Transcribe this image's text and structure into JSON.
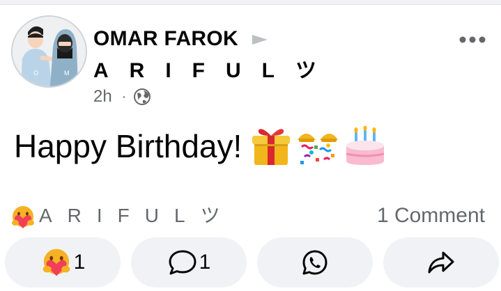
{
  "post": {
    "author": "OMAR FAROK",
    "recipient": "ARIFULツ",
    "time": "2h",
    "separator": "·",
    "privacy_icon": "globe-icon",
    "text": "Happy Birthday!",
    "emojis": [
      "gift",
      "party-poppers",
      "birthday-cake"
    ],
    "avatar_letters": [
      "O",
      "M"
    ]
  },
  "summary": {
    "reaction_icon": "care-reaction-icon",
    "reactor_name": "ARIFULツ",
    "comments_label": "1 Comment"
  },
  "actions": {
    "react_count": "1",
    "comment_count": "1",
    "whatsapp_icon": "whatsapp-icon",
    "share_icon": "share-icon"
  },
  "colors": {
    "secondary_text": "#65676b",
    "pill_background": "#f0f2f5",
    "primary_text": "#050505"
  }
}
